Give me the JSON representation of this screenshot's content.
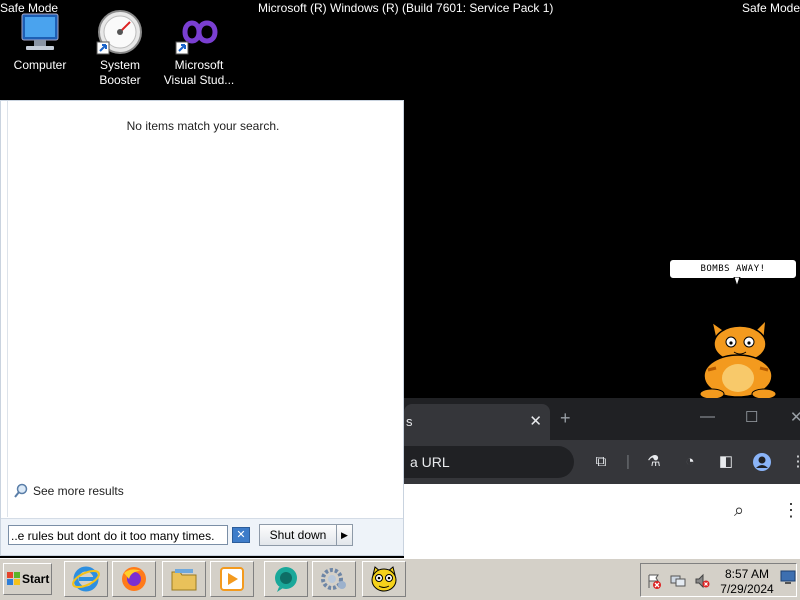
{
  "overlay": {
    "safe_mode_left": "Safe Mode",
    "title": "Microsoft (R) Windows (R) (Build 7601: Service Pack 1)",
    "safe_mode_right": "Safe Mode"
  },
  "desktop_icons": [
    {
      "label_line1": "Computer",
      "label_line2": ""
    },
    {
      "label_line1": "System",
      "label_line2": "Booster"
    },
    {
      "label_line1": "Microsoft",
      "label_line2": "Visual Stud..."
    }
  ],
  "start_menu": {
    "no_items_text": "No items match your search.",
    "see_more_label": "See more results",
    "search_value": "..e rules but dont do it too many times.",
    "shutdown_label": "Shut down"
  },
  "browser": {
    "tab_title": "s",
    "omnibox_text": "a URL"
  },
  "cat": {
    "bubble_text": "BOMBS  AWAY!"
  },
  "taskbar": {
    "start_label": "Start",
    "clock_time": "8:57 AM",
    "clock_date": "7/29/2024"
  },
  "colors": {
    "desktop_bg": "#000000",
    "taskbar_bg": "#d4d0c8",
    "browser_dark": "#202124",
    "browser_toolbar": "#35363a",
    "cat_orange": "#f39a1e"
  }
}
